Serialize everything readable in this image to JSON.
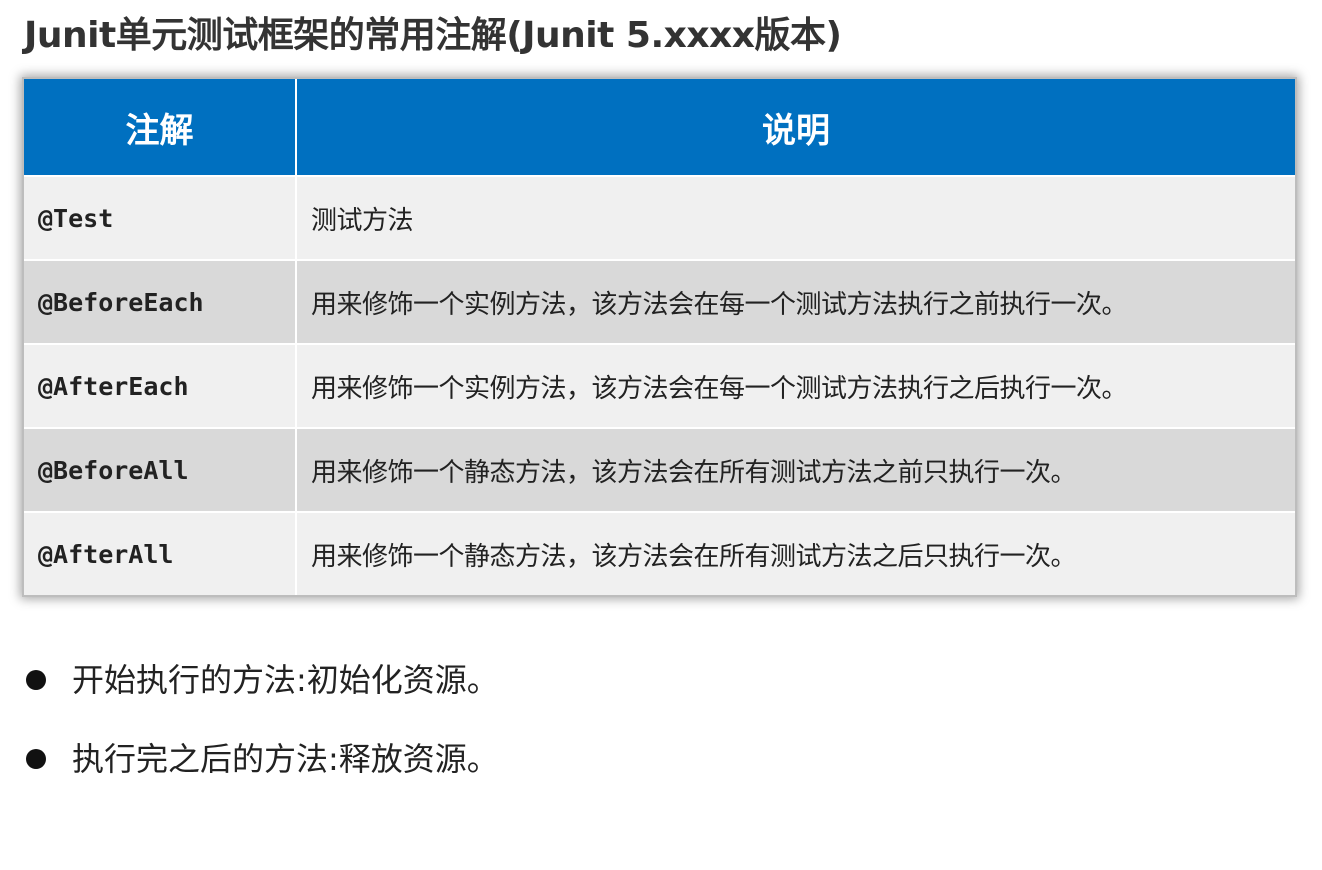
{
  "title": "Junit单元测试框架的常用注解(Junit 5.xxxx版本)",
  "table": {
    "headers": [
      "注解",
      "说明"
    ],
    "rows": [
      {
        "annotation": "@Test",
        "description": "测试方法"
      },
      {
        "annotation": "@BeforeEach",
        "description": "用来修饰一个实例方法，该方法会在每一个测试方法执行之前执行一次。"
      },
      {
        "annotation": "@AfterEach",
        "description": "用来修饰一个实例方法，该方法会在每一个测试方法执行之后执行一次。"
      },
      {
        "annotation": "@BeforeAll",
        "description": "用来修饰一个静态方法，该方法会在所有测试方法之前只执行一次。"
      },
      {
        "annotation": "@AfterAll",
        "description": "用来修饰一个静态方法，该方法会在所有测试方法之后只执行一次。"
      }
    ]
  },
  "notes": [
    "开始执行的方法:初始化资源。",
    "执行完之后的方法:释放资源。"
  ],
  "colors": {
    "header_bg": "#0070c0",
    "row_light": "#f0f0f0",
    "row_dark": "#d9d9d9"
  }
}
